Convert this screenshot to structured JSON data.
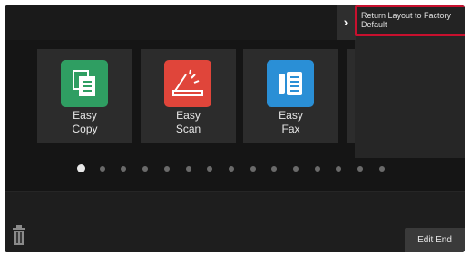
{
  "menu": {
    "return_layout_label": "Return Layout to Factory Default"
  },
  "apps": [
    {
      "label": "Easy\nCopy",
      "icon": "easy-copy-icon",
      "color": "#2f9e62"
    },
    {
      "label": "Easy\nScan",
      "icon": "easy-scan-icon",
      "color": "#e0453a"
    },
    {
      "label": "Easy\nFax",
      "icon": "easy-fax-icon",
      "color": "#2a8fd6"
    }
  ],
  "pagination": {
    "page_count": 15,
    "current_page": 1
  },
  "footer": {
    "edit_end_label": "Edit End"
  },
  "colors": {
    "highlight": "#c8102e",
    "background": "#151515"
  }
}
